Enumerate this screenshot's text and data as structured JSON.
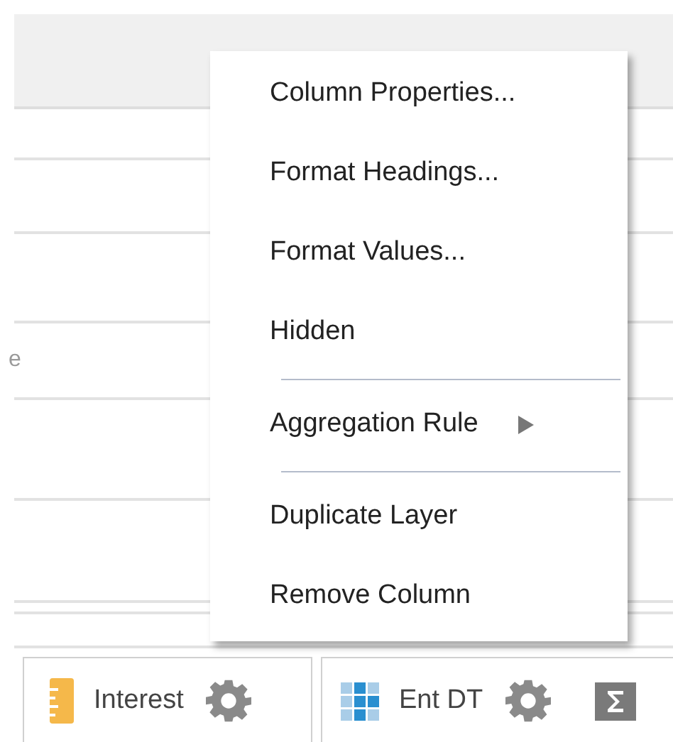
{
  "table": {
    "partial_text": "e"
  },
  "context_menu": {
    "items": [
      {
        "kind": "item",
        "label": "Column Properties..."
      },
      {
        "kind": "item",
        "label": "Format Headings..."
      },
      {
        "kind": "item",
        "label": "Format Values..."
      },
      {
        "kind": "item",
        "label": "Hidden"
      },
      {
        "kind": "separator"
      },
      {
        "kind": "submenu",
        "label": "Aggregation Rule"
      },
      {
        "kind": "separator"
      },
      {
        "kind": "item",
        "label": "Duplicate Layer"
      },
      {
        "kind": "item",
        "label": "Remove Column"
      }
    ]
  },
  "column_chips": [
    {
      "kind": "measure",
      "label": "Interest",
      "aggregation": false
    },
    {
      "kind": "attribute",
      "label": "Ent DT",
      "aggregation": true
    }
  ]
}
